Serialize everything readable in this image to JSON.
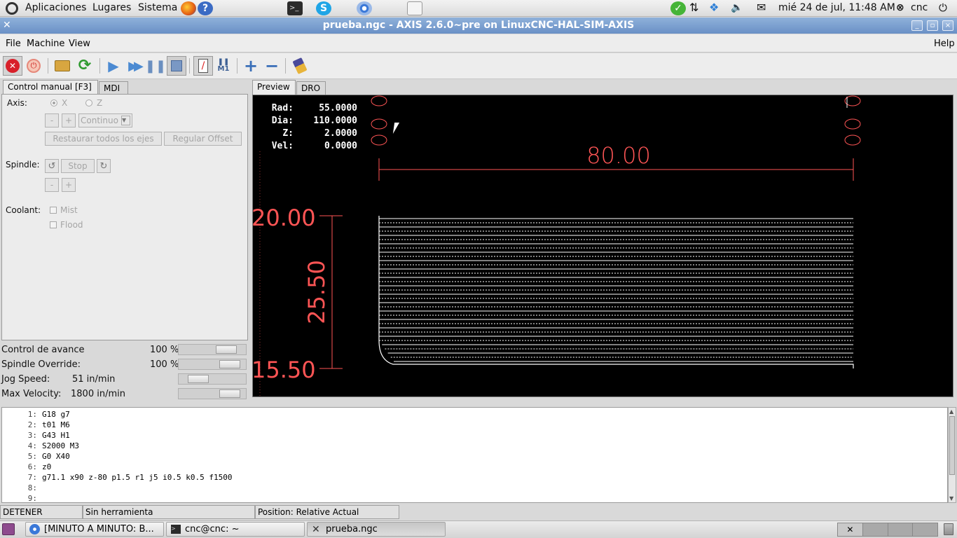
{
  "top_panel": {
    "menus": [
      "Aplicaciones",
      "Lugares",
      "Sistema"
    ],
    "datetime": "mié 24 de jul, 11:48 AM",
    "user": "cnc"
  },
  "window": {
    "title": "prueba.ngc - AXIS 2.6.0~pre on LinuxCNC-HAL-SIM-AXIS"
  },
  "menubar": {
    "file": "File",
    "machine": "Machine",
    "view": "View",
    "help": "Help"
  },
  "left_tabs": [
    "Control manual [F3]",
    "MDI"
  ],
  "right_tabs": [
    "Preview",
    "DRO"
  ],
  "manual": {
    "axis_label": "Axis:",
    "axis_x": "X",
    "axis_z": "Z",
    "minus": "-",
    "plus": "+",
    "increment": "Continuo",
    "home_all": "Restaurar todos los ejes",
    "touch_off": "Regular Offset",
    "spindle_label": "Spindle:",
    "spindle_stop": "Stop",
    "coolant_label": "Coolant:",
    "mist": "Mist",
    "flood": "Flood"
  },
  "overrides": [
    {
      "label": "Control de avance",
      "value": "100 %",
      "level": 0.83
    },
    {
      "label": "Spindle Override:",
      "value": "100 %",
      "level": 0.9
    },
    {
      "label": "Jog Speed:",
      "value": "51 in/min",
      "level": 0.2
    },
    {
      "label": "Max Velocity:",
      "value": "1800 in/min",
      "level": 0.9
    }
  ],
  "dro": [
    {
      "label": "Rad:",
      "value": "55.0000"
    },
    {
      "label": "Dia:",
      "value": "110.0000"
    },
    {
      "label": "Z:",
      "value": "2.0000"
    },
    {
      "label": "Vel:",
      "value": "0.0000"
    }
  ],
  "dimensions": {
    "width": "80.00",
    "top": "20.00",
    "height": "25.50",
    "bottom": "15.50"
  },
  "gcode": [
    {
      "n": "1:",
      "text": "G18 g7"
    },
    {
      "n": "2:",
      "text": "t01 M6"
    },
    {
      "n": "3:",
      "text": "G43 H1"
    },
    {
      "n": "4:",
      "text": "S2000 M3"
    },
    {
      "n": "5:",
      "text": "G0 X40"
    },
    {
      "n": "6:",
      "text": "z0"
    },
    {
      "n": "7:",
      "text": "g71.1 x90 z-80 p1.5 r1 j5 i0.5 k0.5 f1500"
    },
    {
      "n": "8:",
      "text": ""
    },
    {
      "n": "9:",
      "text": ""
    }
  ],
  "status": {
    "state": "DETENER",
    "tool": "Sin herramienta",
    "position": "Position: Relative Actual"
  },
  "taskbar": [
    {
      "label": "[MINUTO A MINUTO: B..."
    },
    {
      "label": "cnc@cnc: ~"
    },
    {
      "label": "prueba.ngc"
    }
  ],
  "colors": {
    "dim": "#ff5555",
    "toolpath": "#ffffff",
    "titlebar": "#7a9dcc"
  }
}
